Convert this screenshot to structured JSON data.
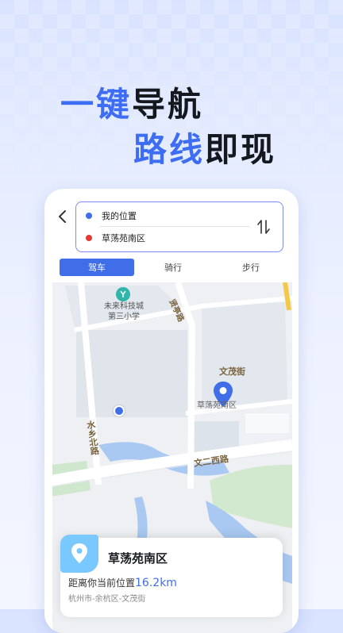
{
  "headline": {
    "line1_part1": "一键",
    "line1_part2": "导航",
    "line2_part1": "路线",
    "line2_part2": "即现"
  },
  "route": {
    "start": "我的位置",
    "end": "草荡苑南区",
    "start_color": "#3f6ee8",
    "end_color": "#e53935"
  },
  "tabs": [
    {
      "label": "驾车",
      "active": true
    },
    {
      "label": "骑行",
      "active": false
    },
    {
      "label": "步行",
      "active": false
    }
  ],
  "map": {
    "poi_school_line1": "未来科技城",
    "poi_school_line2": "第三小学",
    "road_xianyu": "贤亭路",
    "road_wenmao": "文茂街",
    "road_shuixiang": "水乡北路",
    "road_wener_west": "文二西路",
    "destination_label": "草荡苑南区",
    "pin_color": "#3f6ee8"
  },
  "card": {
    "title": "草荡苑南区",
    "distance_prefix": "距离你当前位置",
    "distance_value": "16.2km",
    "address": "杭州市-余杭区-文茂街"
  }
}
